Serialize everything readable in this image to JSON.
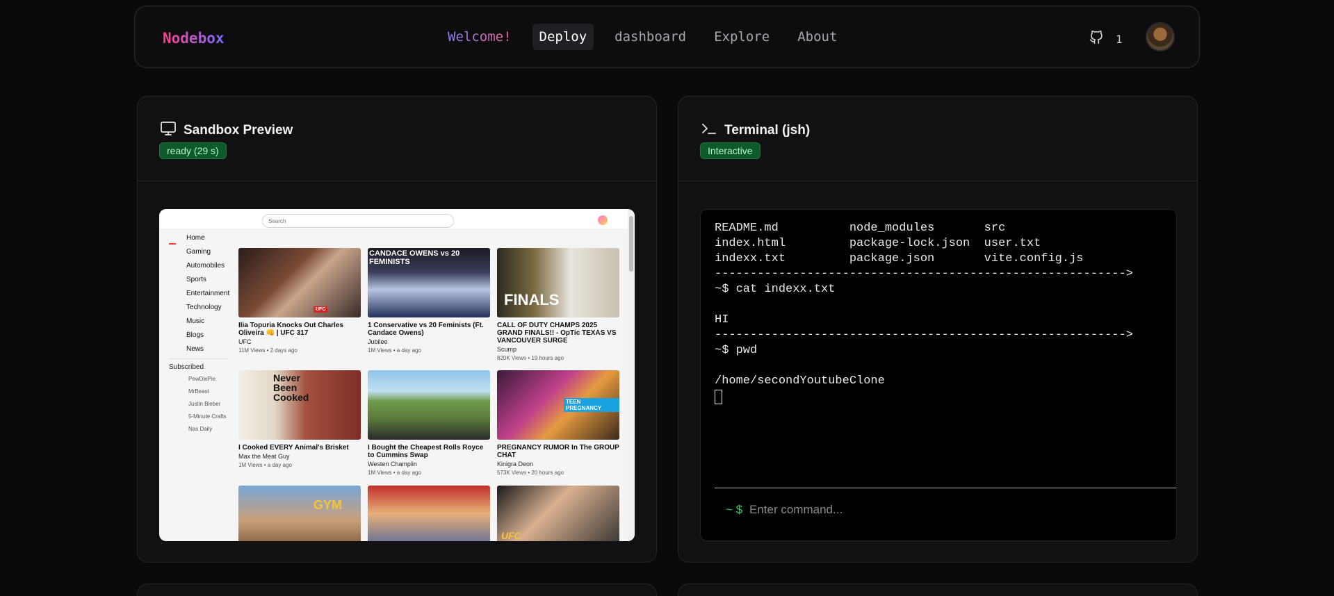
{
  "nav": {
    "brand": "Nodebox",
    "links": [
      "Welcome!",
      "Deploy",
      "dashboard",
      "Explore",
      "About"
    ],
    "github_count": "1"
  },
  "preview_panel": {
    "title": "Sandbox Preview",
    "badge": "ready (29 s)",
    "site": {
      "search_placeholder": "Search",
      "sidebar": [
        "Home",
        "Gaming",
        "Automobiles",
        "Sports",
        "Entertainment",
        "Technology",
        "Music",
        "Blogs",
        "News"
      ],
      "subscribed_heading": "Subscribed",
      "subscribed": [
        "PewDiePie",
        "MrBeast",
        "Justin Bieber",
        "5-Minute Crafts",
        "Nas Daily"
      ],
      "videos": [
        {
          "title": "Ilia Topuria Knocks Out Charles Oliveira 👊 | UFC 317",
          "channel": "UFC",
          "meta": "11M Views • 2 days ago",
          "thumb_text": ""
        },
        {
          "title": "1 Conservative vs 20 Feminists (Ft. Candace Owens)",
          "channel": "Jubilee",
          "meta": "1M Views • a day ago",
          "thumb_text": "CANDACE OWENS vs 20 FEMINISTS"
        },
        {
          "title": "CALL OF DUTY CHAMPS 2025 GRAND FINALS!! - OpTic TEXAS VS VANCOUVER SURGE",
          "channel": "Scump",
          "meta": "820K Views • 19 hours ago",
          "thumb_text": "FINALS"
        },
        {
          "title": "I Cooked EVERY Animal's Brisket",
          "channel": "Max the Meat Guy",
          "meta": "1M Views • a day ago",
          "thumb_text": "Never Been Cooked"
        },
        {
          "title": "I Bought the Cheapest Rolls Royce to Cummins Swap",
          "channel": "Westen Champlin",
          "meta": "1M Views • a day ago",
          "thumb_text": ""
        },
        {
          "title": "PREGNANCY RUMOR In The GROUP CHAT",
          "channel": "Kinigra Deon",
          "meta": "573K Views • 20 hours ago",
          "thumb_text": "TEEN PREGNANCY"
        },
        {
          "title": "",
          "channel": "",
          "meta": "",
          "thumb_text": "GYM"
        },
        {
          "title": "",
          "channel": "",
          "meta": "",
          "thumb_text": ""
        },
        {
          "title": "",
          "channel": "",
          "meta": "",
          "thumb_text": "UFC"
        }
      ]
    }
  },
  "terminal_panel": {
    "title": "Terminal (jsh)",
    "badge": "Interactive",
    "lines": [
      "README.md          node_modules       src",
      "index.html         package-lock.json  user.txt",
      "indexx.txt         package.json       vite.config.js",
      "---------------------------------------------------------->",
      "~$ cat indexx.txt",
      "",
      "HI",
      "---------------------------------------------------------->",
      "~$ pwd",
      "",
      "/home/secondYoutubeClone"
    ],
    "prompt": "~ $",
    "input_placeholder": "Enter command..."
  }
}
